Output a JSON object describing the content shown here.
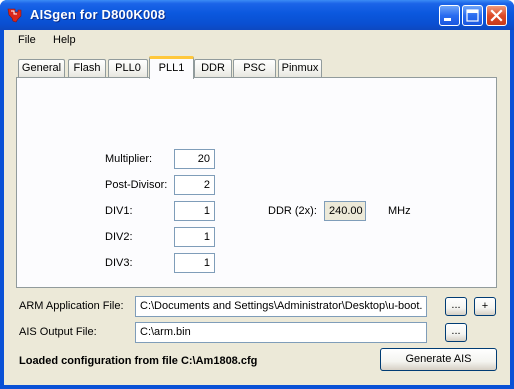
{
  "window": {
    "title": "AISgen for D800K008",
    "icon": "ti-logo-icon",
    "controls": [
      "minimize",
      "maximize",
      "close"
    ]
  },
  "menu": {
    "items": [
      "File",
      "Help"
    ]
  },
  "tabs": [
    "General",
    "Flash",
    "PLL0",
    "PLL1",
    "DDR",
    "PSC",
    "Pinmux"
  ],
  "active_tab": "PLL1",
  "pll1": {
    "multiplier_label": "Multiplier:",
    "multiplier_value": "20",
    "post_divisor_label": "Post-Divisor:",
    "post_divisor_value": "2",
    "div1_label": "DIV1:",
    "div1_value": "1",
    "div2_label": "DIV2:",
    "div2_value": "1",
    "div3_label": "DIV3:",
    "div3_value": "1",
    "ddr_label": "DDR (2x):",
    "ddr_value": "240.00",
    "ddr_unit": "MHz"
  },
  "files": {
    "arm_label": "ARM Application File:",
    "arm_value": "C:\\Documents and Settings\\Administrator\\Desktop\\u-boot.",
    "ais_label": "AIS Output File:",
    "ais_value": "C:\\arm.bin",
    "browse_label": "...",
    "add_label": "+"
  },
  "status_text": "Loaded configuration from file C:\\Am1808.cfg",
  "generate_label": "Generate AIS"
}
